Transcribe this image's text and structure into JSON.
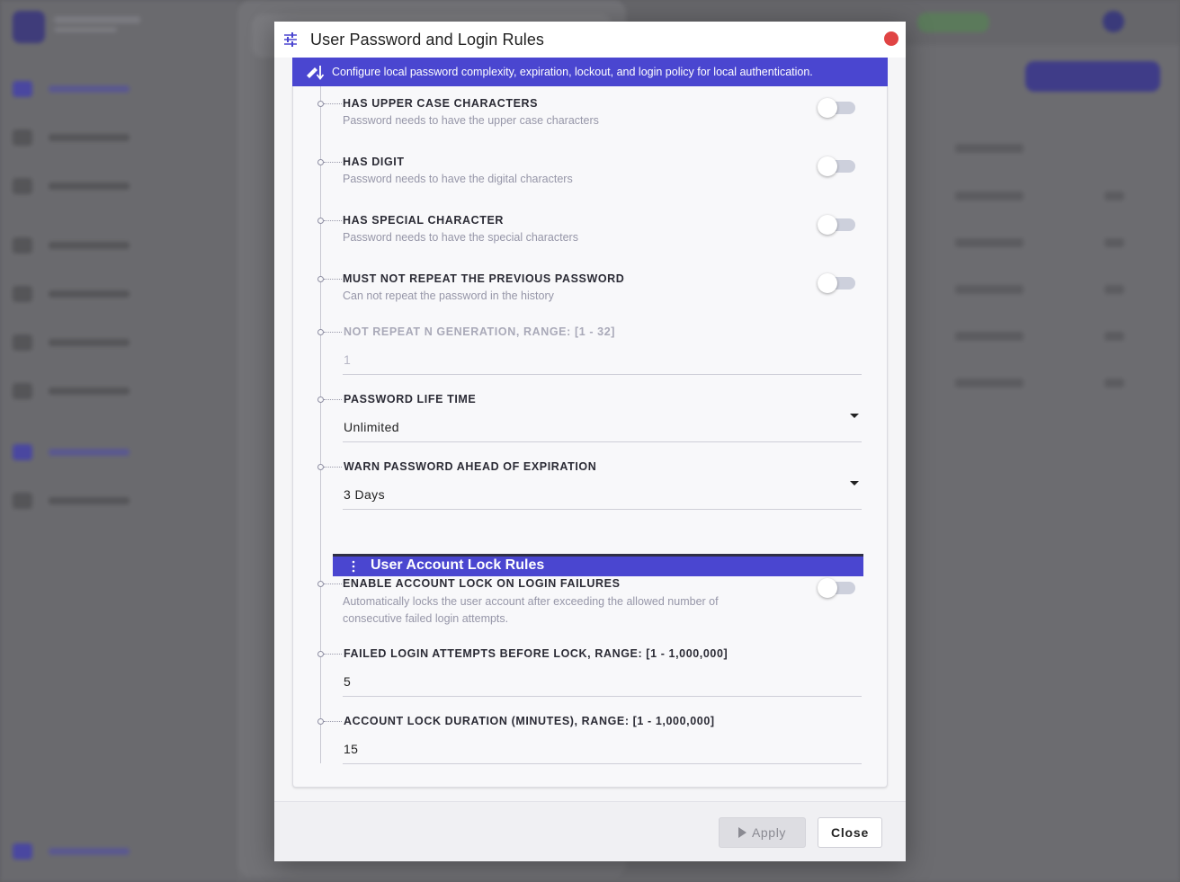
{
  "modal": {
    "title": "User Password and Login Rules",
    "banner_text": "Configure local password complexity, expiration, lockout, and login policy for local authentication."
  },
  "password_rules": [
    {
      "label": "HAS UPPER CASE CHARACTERS",
      "description": "Password needs to have the upper case characters",
      "enabled": false
    },
    {
      "label": "HAS DIGIT",
      "description": "Password needs to have the digital characters",
      "enabled": false
    },
    {
      "label": "HAS SPECIAL CHARACTER",
      "description": "Password needs to have the special characters",
      "enabled": false
    },
    {
      "label": "MUST NOT REPEAT THE PREVIOUS PASSWORD",
      "description": "Can not repeat the password in the history",
      "enabled": false
    }
  ],
  "not_repeat_generation": {
    "label": "NOT REPEAT N GENERATION, RANGE: [1 - 32]",
    "value": "1",
    "disabled": true
  },
  "password_life_time": {
    "label": "PASSWORD LIFE TIME",
    "value": "Unlimited"
  },
  "warn_password_expiration": {
    "label": "WARN PASSWORD AHEAD OF EXPIRATION",
    "value": "3 Days"
  },
  "lock_section": {
    "title": "User Account Lock Rules"
  },
  "account_lock": {
    "label": "ENABLE ACCOUNT LOCK ON LOGIN FAILURES",
    "description_line1": "Automatically locks the user account after exceeding the allowed number of",
    "description_line2": "consecutive failed login attempts.",
    "enabled": false
  },
  "failed_attempts": {
    "label": "FAILED LOGIN ATTEMPTS BEFORE LOCK, RANGE: [1 - 1,000,000]",
    "value": "5"
  },
  "lock_duration": {
    "label": "ACCOUNT LOCK DURATION (MINUTES), RANGE: [1 - 1,000,000]",
    "value": "15"
  },
  "footer": {
    "apply_label": "Apply",
    "close_label": "Close"
  },
  "colors": {
    "accent": "#4a46d0",
    "close_dot": "#e04444",
    "toggle_track": "#cdd0dc"
  },
  "icons": {
    "header": "tune-icon",
    "banner": "sort-icon",
    "section": "kebab-icon",
    "apply": "play-icon"
  }
}
